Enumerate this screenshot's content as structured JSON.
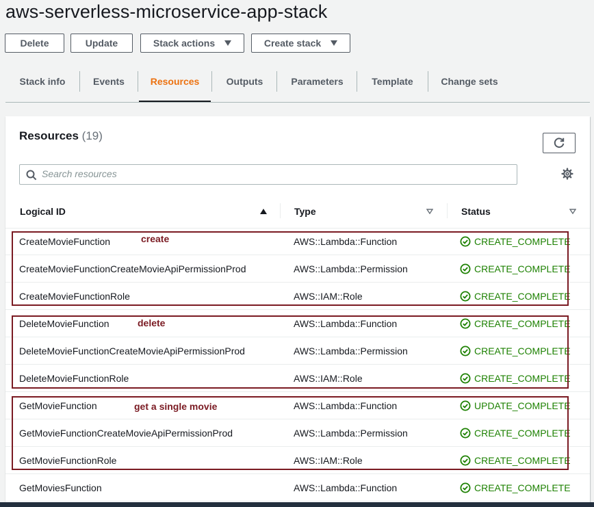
{
  "stack_name": "aws-serverless-microservice-app-stack",
  "actions": {
    "delete": "Delete",
    "update": "Update",
    "stack_actions": "Stack actions",
    "create_stack": "Create stack"
  },
  "tabs": [
    {
      "label": "Stack info",
      "active": false
    },
    {
      "label": "Events",
      "active": false
    },
    {
      "label": "Resources",
      "active": true
    },
    {
      "label": "Outputs",
      "active": false
    },
    {
      "label": "Parameters",
      "active": false
    },
    {
      "label": "Template",
      "active": false
    },
    {
      "label": "Change sets",
      "active": false
    }
  ],
  "resources": {
    "title": "Resources",
    "count": "(19)",
    "search_placeholder": "Search resources",
    "columns": {
      "logical_id": "Logical ID",
      "type": "Type",
      "status": "Status"
    },
    "rows": [
      {
        "logical_id": "CreateMovieFunction",
        "type": "AWS::Lambda::Function",
        "status": "CREATE_COMPLETE"
      },
      {
        "logical_id": "CreateMovieFunctionCreateMovieApiPermissionProd",
        "type": "AWS::Lambda::Permission",
        "status": "CREATE_COMPLETE"
      },
      {
        "logical_id": "CreateMovieFunctionRole",
        "type": "AWS::IAM::Role",
        "status": "CREATE_COMPLETE"
      },
      {
        "logical_id": "DeleteMovieFunction",
        "type": "AWS::Lambda::Function",
        "status": "CREATE_COMPLETE"
      },
      {
        "logical_id": "DeleteMovieFunctionCreateMovieApiPermissionProd",
        "type": "AWS::Lambda::Permission",
        "status": "CREATE_COMPLETE"
      },
      {
        "logical_id": "DeleteMovieFunctionRole",
        "type": "AWS::IAM::Role",
        "status": "CREATE_COMPLETE"
      },
      {
        "logical_id": "GetMovieFunction",
        "type": "AWS::Lambda::Function",
        "status": "UPDATE_COMPLETE"
      },
      {
        "logical_id": "GetMovieFunctionCreateMovieApiPermissionProd",
        "type": "AWS::Lambda::Permission",
        "status": "CREATE_COMPLETE"
      },
      {
        "logical_id": "GetMovieFunctionRole",
        "type": "AWS::IAM::Role",
        "status": "CREATE_COMPLETE"
      },
      {
        "logical_id": "GetMoviesFunction",
        "type": "AWS::Lambda::Function",
        "status": "CREATE_COMPLETE"
      }
    ]
  },
  "annotations": [
    {
      "label": "create"
    },
    {
      "label": "delete"
    },
    {
      "label": "get a single movie"
    }
  ],
  "colors": {
    "accent": "#ec7211",
    "success": "#1d8102",
    "annotation": "#7a1a22"
  },
  "icons": {
    "refresh": "refresh-icon",
    "settings": "gear-icon",
    "search": "search-icon",
    "status": "check-circle-icon"
  }
}
